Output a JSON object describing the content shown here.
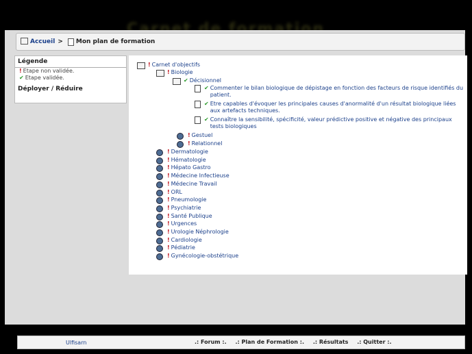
{
  "bg_title": "Carnet de formation",
  "breadcrumb": {
    "home": "Accueil",
    "separator": ">",
    "current": "Mon plan de formation"
  },
  "legend": {
    "title": "Légende",
    "not_validated": "Etape non validée.",
    "validated": "Etape validée.",
    "toggle": "Déployer / Réduire"
  },
  "tree": {
    "root": "Carnet d'objectifs",
    "biologie": "Biologie",
    "decisionnel": "Décisionnel",
    "objectives": [
      "Commenter le bilan biologique de dépistage en fonction des facteurs de risque identifiés du patient.",
      "Etre capables d'évoquer les principales causes d'anormalité d'un résultat biologique liées aux artefacts techniques.",
      "Connaître la sensibilité, spécificité, valeur prédictive positive et négative des principaux tests biologiques"
    ],
    "gestuel": "Gestuel",
    "relationnel": "Relationnel",
    "specialties": [
      "Dermatologie",
      "Hématologie",
      "Hépato Gastro",
      "Médecine Infectieuse",
      "Médecine Travail",
      "ORL",
      "Pneumologie",
      "Psychiatrie",
      "Santé Publique",
      "Urgences",
      "Urologie Néphrologie",
      "Cardiologie",
      "Pédiatrie",
      "Gynécologie-obstétrique"
    ]
  },
  "footer": {
    "user": "Ulfisarn",
    "forum": ".: Forum :.",
    "plan": ".: Plan de Formation :.",
    "results": ".: Résultats",
    "quit": ".: Quitter :."
  },
  "colors": {
    "accent": "#1a3f8a",
    "invalid": "#c0101a",
    "valid": "#2a9a2a"
  }
}
